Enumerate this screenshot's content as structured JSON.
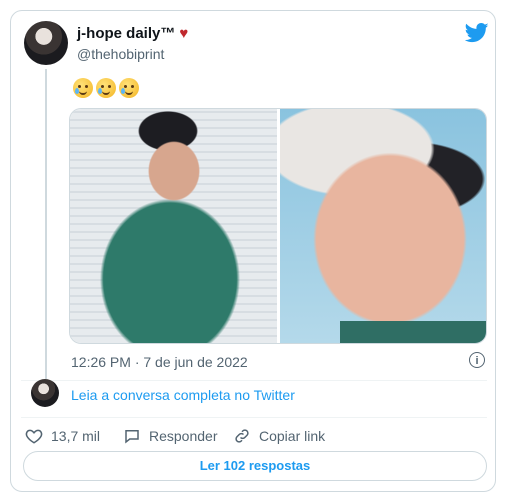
{
  "author": {
    "name": "j-hope daily™",
    "handle": "@thehobiprint",
    "heart": "♥"
  },
  "tweet": {
    "emojis": [
      "face-holding-back-tears",
      "face-holding-back-tears",
      "face-holding-back-tears"
    ],
    "timestamp": "12:26 PM · 7 de jun de 2022"
  },
  "readmore": {
    "label": "Leia a conversa completa no Twitter"
  },
  "actions": {
    "likes": "13,7 mil",
    "reply": "Responder",
    "copy": "Copiar link"
  },
  "replies_button": "Ler 102 respostas",
  "colors": {
    "accent": "#1d9bf0",
    "text": "#0f1419",
    "muted": "#536471",
    "heart": "#c0282d"
  }
}
